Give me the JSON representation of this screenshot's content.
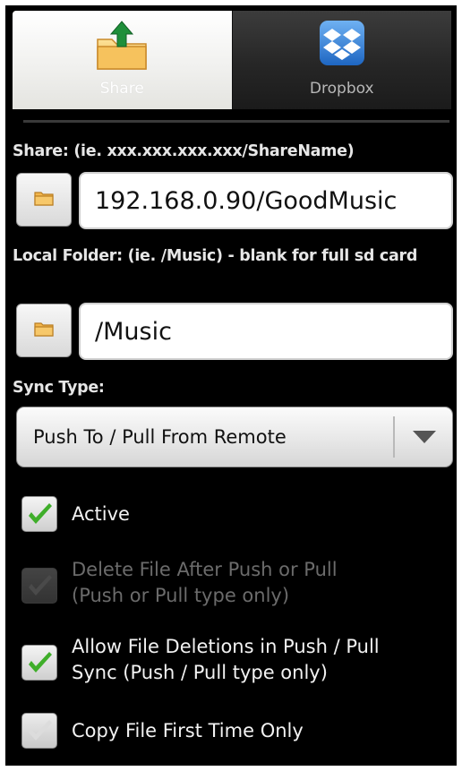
{
  "tabs": [
    {
      "label": "Share",
      "icon": "folder-upload-icon",
      "selected": true
    },
    {
      "label": "Dropbox",
      "icon": "dropbox-icon",
      "selected": false
    }
  ],
  "share": {
    "label": "Share: (ie. xxx.xxx.xxx.xxx/ShareName)",
    "value": "192.168.0.90/GoodMusic",
    "browse_icon": "folder-icon"
  },
  "local_folder": {
    "label": "Local Folder: (ie. /Music) - blank for full sd card",
    "value": "/Music",
    "browse_icon": "folder-icon"
  },
  "sync_type": {
    "label": "Sync Type:",
    "selected": "Push To / Pull From Remote",
    "icon": "dropdown-arrow-icon"
  },
  "options": [
    {
      "label": "Active",
      "checked": true,
      "enabled": true
    },
    {
      "label_line1": "Delete File After Push or Pull",
      "label_line2": "(Push or Pull type only)",
      "checked": false,
      "enabled": false
    },
    {
      "label_line1": "Allow File Deletions in Push / Pull",
      "label_line2": "Sync (Push / Pull type only)",
      "checked": true,
      "enabled": true
    },
    {
      "label": "Copy File First Time Only",
      "checked": false,
      "enabled": true
    }
  ],
  "colors": {
    "background": "#000000",
    "check_green": "#3fae2a",
    "folder_yellow": "#f3b64c",
    "arrow_green": "#1f8f3a",
    "dropbox_blue": "#2f7fd6"
  }
}
